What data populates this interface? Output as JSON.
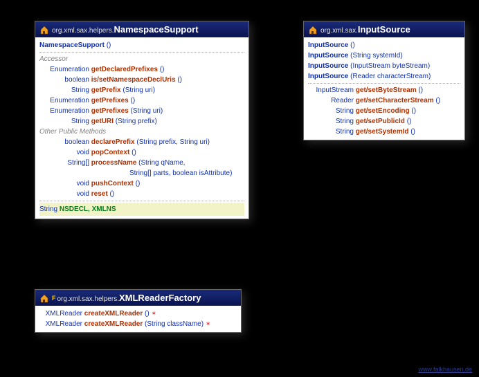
{
  "watermark": "www.falkhausen.de",
  "cards": {
    "ns": {
      "pkg": "org.xml.sax.helpers.",
      "cls": "NamespaceSupport",
      "constructors": [
        {
          "name": "NamespaceSupport",
          "params": "()"
        }
      ],
      "sections": [
        {
          "label": "Accessor",
          "rows": [
            {
              "ret": "Enumeration",
              "name": "getDeclaredPrefixes",
              "params": "()"
            },
            {
              "ret": "boolean",
              "name": "is/setNamespaceDeclUris",
              "params": "()"
            },
            {
              "ret": "String",
              "name": "getPrefix",
              "params": "(String uri)"
            },
            {
              "ret": "Enumeration",
              "name": "getPrefixes",
              "params": "()"
            },
            {
              "ret": "Enumeration",
              "name": "getPrefixes",
              "params": "(String uri)"
            },
            {
              "ret": "String",
              "name": "getURI",
              "params": "(String prefix)"
            }
          ]
        },
        {
          "label": "Other Public Methods",
          "rows": [
            {
              "ret": "boolean",
              "name": "declarePrefix",
              "params": "(String prefix, String uri)"
            },
            {
              "ret": "void",
              "name": "popContext",
              "params": "()"
            },
            {
              "ret": "String[]",
              "name": "processName",
              "params": "(String qName,"
            },
            {
              "ret": "",
              "name": "",
              "params": "String[] parts, boolean isAttribute)",
              "cont": true
            },
            {
              "ret": "void",
              "name": "pushContext",
              "params": "()"
            },
            {
              "ret": "void",
              "name": "reset",
              "params": "()"
            }
          ]
        }
      ],
      "consts": {
        "type": "String",
        "names": "NSDECL, XMLNS"
      }
    },
    "is": {
      "pkg": "org.xml.sax.",
      "cls": "InputSource",
      "constructors": [
        {
          "name": "InputSource",
          "params": "()"
        },
        {
          "name": "InputSource",
          "params": "(String systemId)"
        },
        {
          "name": "InputSource",
          "params": "(InputStream byteStream)"
        },
        {
          "name": "InputSource",
          "params": "(Reader characterStream)"
        }
      ],
      "rows": [
        {
          "ret": "InputStream",
          "name": "get/setByteStream",
          "params": "()"
        },
        {
          "ret": "Reader",
          "name": "get/setCharacterStream",
          "params": "()"
        },
        {
          "ret": "String",
          "name": "get/setEncoding",
          "params": "()"
        },
        {
          "ret": "String",
          "name": "get/setPublicId",
          "params": "()"
        },
        {
          "ret": "String",
          "name": "get/setSystemId",
          "params": "()"
        }
      ]
    },
    "xrf": {
      "pkg": "org.xml.sax.helpers.",
      "cls": "XMLReaderFactory",
      "rows": [
        {
          "ret": "XMLReader",
          "name": "createXMLReader",
          "params": "()",
          "throws": true
        },
        {
          "ret": "XMLReader",
          "name": "createXMLReader",
          "params": "(String className)",
          "throws": true
        }
      ]
    }
  }
}
